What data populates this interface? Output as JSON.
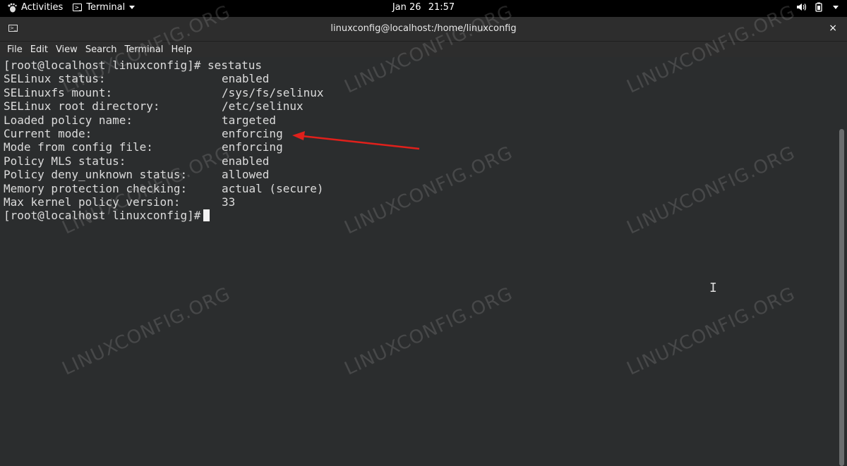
{
  "topbar": {
    "activities": "Activities",
    "app_menu": "Terminal",
    "clock_date": "Jan 26",
    "clock_time": "21:57"
  },
  "window": {
    "title": "linuxconfig@localhost:/home/linuxconfig",
    "close_glyph": "×"
  },
  "menu": [
    "File",
    "Edit",
    "View",
    "Search",
    "Terminal",
    "Help"
  ],
  "terminal": {
    "prompt": "[root@localhost linuxconfig]# ",
    "command": "sestatus",
    "rows": [
      {
        "label": "SELinux status:",
        "value": "enabled"
      },
      {
        "label": "SELinuxfs mount:",
        "value": "/sys/fs/selinux"
      },
      {
        "label": "SELinux root directory:",
        "value": "/etc/selinux"
      },
      {
        "label": "Loaded policy name:",
        "value": "targeted"
      },
      {
        "label": "Current mode:",
        "value": "enforcing"
      },
      {
        "label": "Mode from config file:",
        "value": "enforcing"
      },
      {
        "label": "Policy MLS status:",
        "value": "enabled"
      },
      {
        "label": "Policy deny_unknown status:",
        "value": "allowed"
      },
      {
        "label": "Memory protection checking:",
        "value": "actual (secure)"
      },
      {
        "label": "Max kernel policy version:",
        "value": "33"
      }
    ],
    "final_prompt": "[root@localhost linuxconfig]#"
  },
  "watermark": "LINUXCONFIG.ORG",
  "colors": {
    "annotation_arrow": "#e0201b",
    "terminal_bg": "#2b2d2e"
  }
}
